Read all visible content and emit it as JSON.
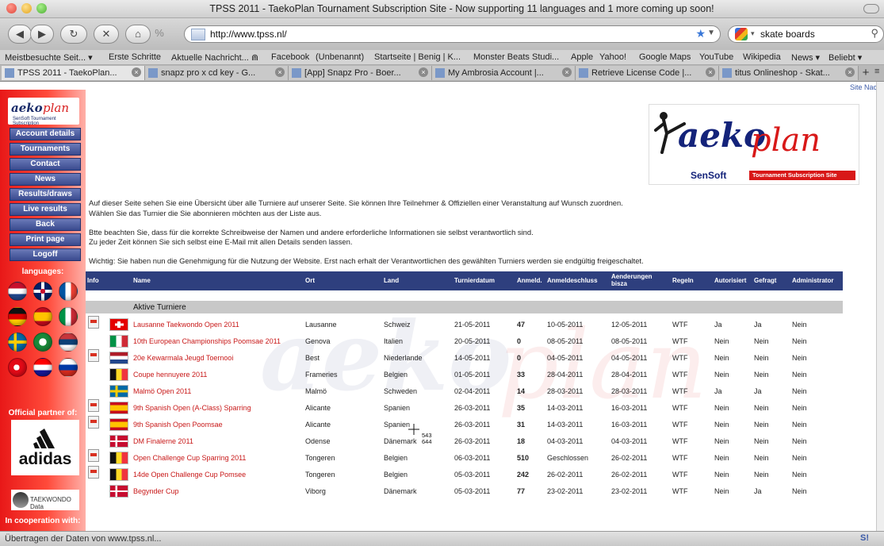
{
  "window": {
    "title": "TPSS 2011 - TaekoPlan Tournament Subscription Site - Now supporting 11 languages and 1 more coming up soon!"
  },
  "toolbar": {
    "url": "http://www.tpss.nl/",
    "search_value": "skate boards"
  },
  "bookmarks": [
    "Meistbesuchte Seit... ▾",
    "Erste Schritte",
    "Aktuelle Nachricht... ⋒",
    "Facebook",
    "(Unbenannt)",
    "Startseite | Benig | K...",
    "Monster Beats Studi...",
    "Apple",
    "Yahoo!",
    "Google Maps",
    "YouTube",
    "Wikipedia",
    "News ▾",
    "Beliebt ▾"
  ],
  "tabs": [
    {
      "label": "TPSS 2011 - TaekoPlan..."
    },
    {
      "label": "snapz pro x cd key - G..."
    },
    {
      "label": "[App] Snapz Pro - Boer..."
    },
    {
      "label": "My Ambrosia Account |..."
    },
    {
      "label": "Retrieve License Code |..."
    },
    {
      "label": "titus Onlineshop - Skat..."
    }
  ],
  "site_nachr": "Site Nachr",
  "sidebar": {
    "logo": {
      "main": "aeko",
      "script": "plan",
      "small": "SenSoft Tournament Subscription"
    },
    "nav": [
      "Account details",
      "Tournaments",
      "Contact",
      "News",
      "Results/draws",
      "Live results",
      "Back",
      "Print page",
      "Logoff"
    ],
    "languages_title": "languages:",
    "partner_title": "Official partner of:",
    "adidas": "adidas",
    "tkd": "TAEKWONDO Data",
    "coop_title": "In cooperation with:"
  },
  "banner": {
    "main": "aeko",
    "script": "plan",
    "sensoft": "SenSoft",
    "tagline": "Tournament Subscription Site"
  },
  "intro": [
    "Auf dieser Seite sehen Sie eine Übersicht über alle Turniere auf unserer Seite. Sie können Ihre Teilnehmer & Offiziellen einer Veranstaltung auf Wunsch zuordnen.",
    "Wählen Sie das Turnier die Sie abonnieren möchten aus der Liste aus.",
    "Btte beachten Sie, dass für die korrekte Schreibweise der Namen und andere erforderliche Informationen sie selbst verantwortlich sind.",
    "Zu jeder Zeit können Sie sich selbst eine E-Mail mit allen Details senden lassen.",
    "Wichtig: Sie haben nun die Genehmigung für die Nutzung der Website. Erst nach erhalt der Verantwortlichen des gewählten Turniers werden sie endgültig freigeschaltet."
  ],
  "table": {
    "headers": {
      "info": "Info",
      "name": "Name",
      "ort": "Ort",
      "land": "Land",
      "datum": "Turnierdatum",
      "anmeld": "Anmeld.",
      "schluss": "Anmeldeschluss",
      "aenderungen_1": "Aenderungen",
      "aenderungen_2": "bisza",
      "regeln": "Regeln",
      "autorisiert": "Autorisiert",
      "gefragt": "Gefragt",
      "admin": "Administrator"
    },
    "section": "Aktive Turniere",
    "rows": [
      {
        "pdf": true,
        "flag": "CH",
        "name": "Lausanne Taekwondo Open 2011",
        "ort": "Lausanne",
        "land": "Schweiz",
        "datum": "21-05-2011",
        "anmeld": "47",
        "schluss": "10-05-2011",
        "aend": "12-05-2011",
        "regeln": "WTF",
        "auth": "Ja",
        "gefragt": "Ja",
        "admin": "Nein"
      },
      {
        "pdf": false,
        "flag": "IT",
        "name": "10th European Championships Poomsae 2011",
        "ort": "Genova",
        "land": "Italien",
        "datum": "20-05-2011",
        "anmeld": "0",
        "schluss": "08-05-2011",
        "aend": "08-05-2011",
        "regeln": "WTF",
        "auth": "Nein",
        "gefragt": "Nein",
        "admin": "Nein"
      },
      {
        "pdf": true,
        "flag": "NL",
        "name": "20e Kewarmala Jeugd Toernooi",
        "ort": "Best",
        "land": "Niederlande",
        "datum": "14-05-2011",
        "anmeld": "0",
        "schluss": "04-05-2011",
        "aend": "04-05-2011",
        "regeln": "WTF",
        "auth": "Nein",
        "gefragt": "Nein",
        "admin": "Nein"
      },
      {
        "pdf": false,
        "flag": "BE",
        "name": "Coupe hennuyere 2011",
        "ort": "Frameries",
        "land": "Belgien",
        "datum": "01-05-2011",
        "anmeld": "33",
        "schluss": "28-04-2011",
        "aend": "28-04-2011",
        "regeln": "WTF",
        "auth": "Nein",
        "gefragt": "Nein",
        "admin": "Nein"
      },
      {
        "pdf": false,
        "flag": "SE",
        "name": "Malmö Open 2011",
        "ort": "Malmö",
        "land": "Schweden",
        "datum": "02-04-2011",
        "anmeld": "14",
        "schluss": "28-03-2011",
        "aend": "28-03-2011",
        "regeln": "WTF",
        "auth": "Ja",
        "gefragt": "Ja",
        "admin": "Nein"
      },
      {
        "pdf": true,
        "flag": "ES",
        "name": "9th Spanish Open (A-Class) Sparring",
        "ort": "Alicante",
        "land": "Spanien",
        "datum": "26-03-2011",
        "anmeld": "35",
        "schluss": "14-03-2011",
        "aend": "16-03-2011",
        "regeln": "WTF",
        "auth": "Nein",
        "gefragt": "Nein",
        "admin": "Nein"
      },
      {
        "pdf": true,
        "flag": "ES",
        "name": "9th Spanish Open Poomsae",
        "ort": "Alicante",
        "land": "Spanien",
        "datum": "26-03-2011",
        "anmeld": "31",
        "schluss": "14-03-2011",
        "aend": "16-03-2011",
        "regeln": "WTF",
        "auth": "Nein",
        "gefragt": "Nein",
        "admin": "Nein"
      },
      {
        "pdf": false,
        "flag": "DK",
        "name": "DM Finalerne 2011",
        "ort": "Odense",
        "land": "Dänemark",
        "datum": "26-03-2011",
        "anmeld": "18",
        "schluss": "04-03-2011",
        "aend": "04-03-2011",
        "regeln": "WTF",
        "auth": "Nein",
        "gefragt": "Nein",
        "admin": "Nein"
      },
      {
        "pdf": true,
        "flag": "BE",
        "name": "Open Challenge Cup Sparring 2011",
        "ort": "Tongeren",
        "land": "Belgien",
        "datum": "06-03-2011",
        "anmeld": "510",
        "schluss": "Geschlossen",
        "aend": "26-02-2011",
        "regeln": "WTF",
        "auth": "Nein",
        "gefragt": "Nein",
        "admin": "Nein"
      },
      {
        "pdf": true,
        "flag": "BE",
        "name": "14de Open Challenge Cup Pomsee",
        "ort": "Tongeren",
        "land": "Belgien",
        "datum": "05-03-2011",
        "anmeld": "242",
        "schluss": "26-02-2011",
        "aend": "26-02-2011",
        "regeln": "WTF",
        "auth": "Nein",
        "gefragt": "Nein",
        "admin": "Nein"
      },
      {
        "pdf": false,
        "flag": "DK",
        "name": "Begynder Cup",
        "ort": "Viborg",
        "land": "Dänemark",
        "datum": "05-03-2011",
        "anmeld": "77",
        "schluss": "23-02-2011",
        "aend": "23-02-2011",
        "regeln": "WTF",
        "auth": "Nein",
        "gefragt": "Ja",
        "admin": "Nein"
      }
    ]
  },
  "cursor_coords": [
    "543",
    "644"
  ],
  "status": {
    "text": "Übertragen der Daten von www.tpss.nl...",
    "icon": "S!"
  }
}
